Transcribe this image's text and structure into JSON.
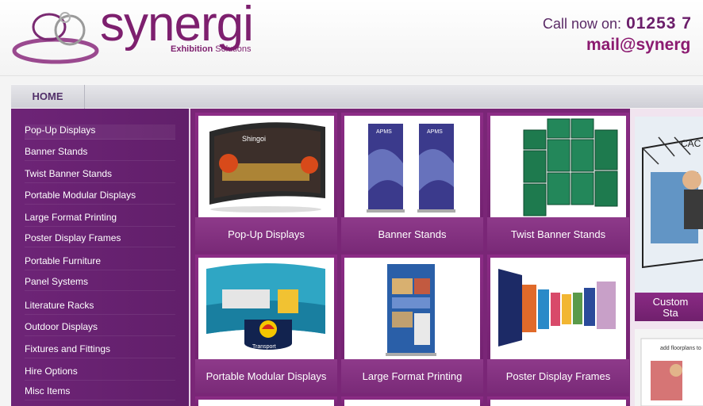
{
  "brand": {
    "name": "synergi",
    "tagline_bold": "Exhibition",
    "tagline_rest": "Solutions"
  },
  "contact": {
    "call_label": "Call now on:",
    "phone": "01253 7",
    "email": "mail@synerg"
  },
  "nav": {
    "home": "HOME"
  },
  "sidebar": {
    "items": [
      "Pop-Up Displays",
      "Banner Stands",
      "Twist Banner Stands",
      "Portable Modular Displays",
      "Large Format Printing",
      "Poster Display Frames",
      "Portable Furniture",
      "Panel Systems",
      "Literature Racks",
      "Outdoor Displays",
      "Fixtures and Fittings",
      "Hire Options",
      "Misc Items"
    ]
  },
  "products": [
    {
      "label": "Pop-Up Displays",
      "image": "popup-display-photo"
    },
    {
      "label": "Banner Stands",
      "image": "banner-stands-photo"
    },
    {
      "label": "Twist Banner Stands",
      "image": "twist-banner-photo"
    },
    {
      "label": "Portable Modular Displays",
      "image": "modular-display-photo"
    },
    {
      "label": "Large Format Printing",
      "image": "large-format-photo"
    },
    {
      "label": "Poster Display Frames",
      "image": "poster-frames-photo"
    }
  ],
  "promo": {
    "caption_line1": "Custom",
    "caption_line2": "Sta"
  },
  "photo_text": {
    "popup_brand": "Shingoi",
    "banner_brand": "APMS",
    "modular_badge": "Transport",
    "promo_sign": "CAC",
    "promo2_text": "add floorplans to"
  },
  "colors": {
    "brand_purple": "#7d1f6e",
    "sidebar": "#6e2477",
    "content_bg": "#7a2677"
  }
}
